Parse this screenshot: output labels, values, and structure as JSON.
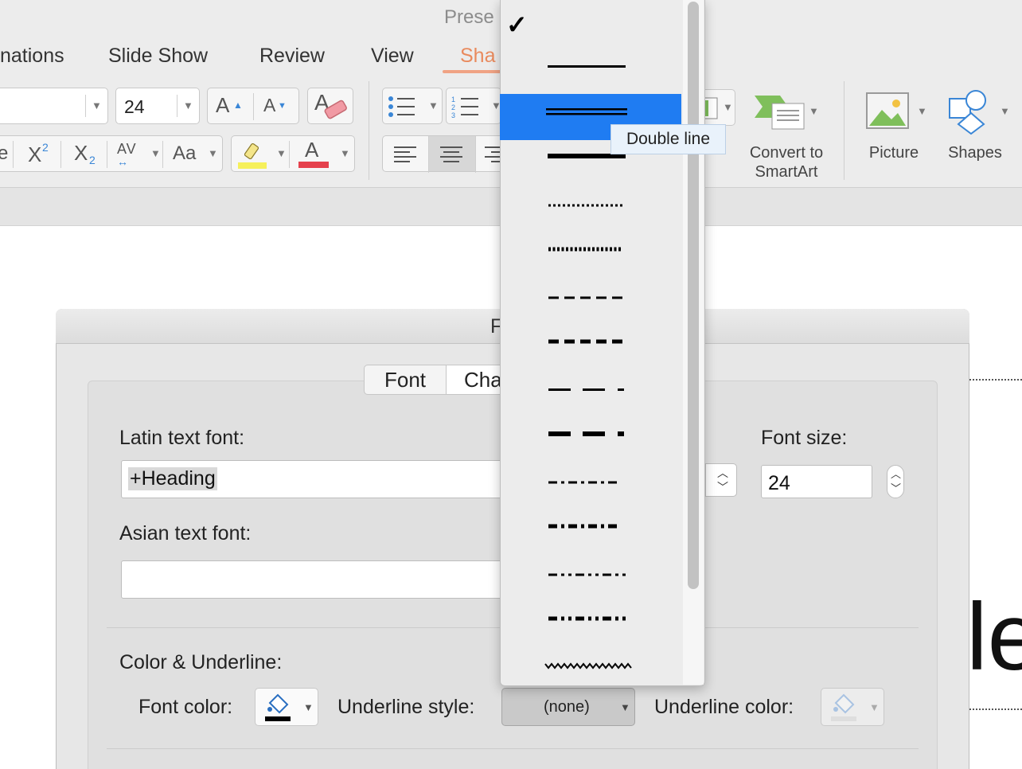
{
  "app": {
    "title_partial": "Prese"
  },
  "ribbon": {
    "tabs": [
      {
        "label": "nations"
      },
      {
        "label": "Slide Show"
      },
      {
        "label": "Review"
      },
      {
        "label": "View"
      },
      {
        "label": "Sha"
      }
    ],
    "font_size": "24",
    "grow_font": "A",
    "shrink_font": "A",
    "superscript": "X",
    "superscript_mark": "2",
    "subscript": "X",
    "subscript_mark": "2",
    "spacing": "AV",
    "change_case": "Aa",
    "font_color_glyph": "A",
    "convert_smartart_line1": "Convert to",
    "convert_smartart_line2": "SmartArt",
    "picture": "Picture",
    "shapes": "Shapes"
  },
  "dialog": {
    "title_partial": "F",
    "tabs": [
      {
        "label": "Font"
      },
      {
        "label": "Cha"
      }
    ],
    "latin_label": "Latin text font:",
    "latin_value": "+Heading",
    "asian_label": "Asian text font:",
    "asian_value": "",
    "size_label": "Font size:",
    "size_value": "24",
    "color_underline_label": "Color & Underline:",
    "font_color_label": "Font color:",
    "underline_style_label": "Underline style:",
    "underline_style_value": "(none)",
    "underline_color_label": "Underline color:"
  },
  "slide": {
    "text_partial": "le"
  },
  "underline_menu": {
    "checkmark": "✓",
    "items": [
      {
        "style": "none"
      },
      {
        "style": "single"
      },
      {
        "style": "double"
      },
      {
        "style": "thick"
      },
      {
        "style": "dotted"
      },
      {
        "style": "dotted-heavy"
      },
      {
        "style": "dash"
      },
      {
        "style": "dash-heavy"
      },
      {
        "style": "long-dash"
      },
      {
        "style": "long-dash-heavy"
      },
      {
        "style": "dot-dash"
      },
      {
        "style": "dot-dash-heavy"
      },
      {
        "style": "dot-dot-dash"
      },
      {
        "style": "dot-dot-dash-heavy"
      },
      {
        "style": "wavy"
      }
    ],
    "selected": "double",
    "tooltip": "Double line"
  },
  "colors": {
    "accent_tab": "#e98a5d",
    "menu_selection": "#1f7cf2",
    "highlight_yellow": "#f6f05b",
    "font_color_red": "#e5414d",
    "list_blue": "#3a86d6"
  }
}
